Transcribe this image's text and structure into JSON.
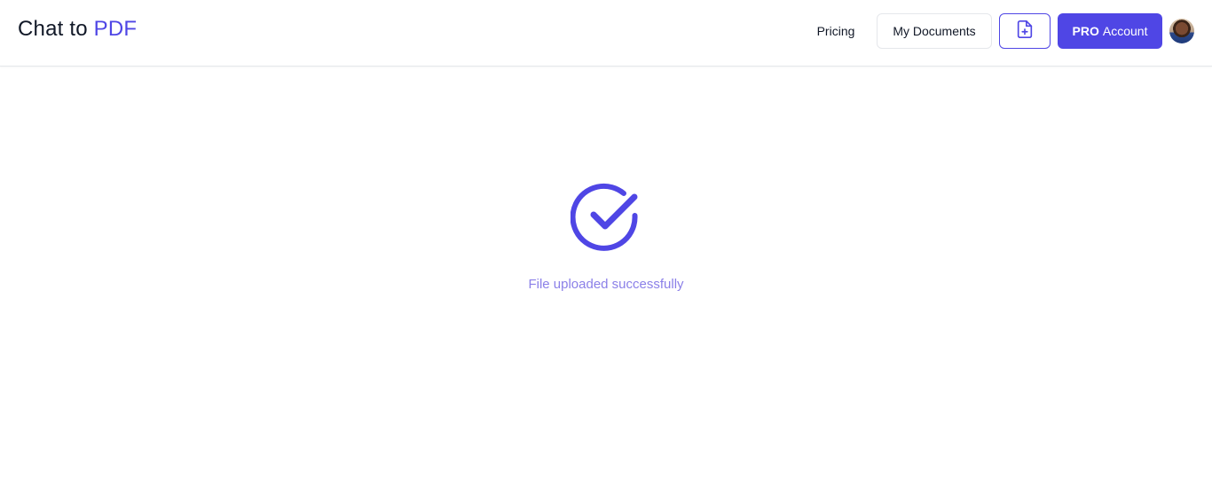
{
  "header": {
    "logo_prefix": "Chat to",
    "logo_accent": "PDF",
    "nav_pricing": "Pricing",
    "my_documents": "My Documents",
    "upload_icon": "file-plus-icon",
    "pro_label_bold": "PRO",
    "pro_label_rest": "Account",
    "avatar_icon": "user-avatar"
  },
  "main": {
    "status_icon": "check-circle-icon",
    "status_text": "File uploaded successfully"
  },
  "colors": {
    "accent": "#4f46e5",
    "status_text": "#8b80e8",
    "text_dark": "#111827",
    "border": "#e5e7eb"
  }
}
